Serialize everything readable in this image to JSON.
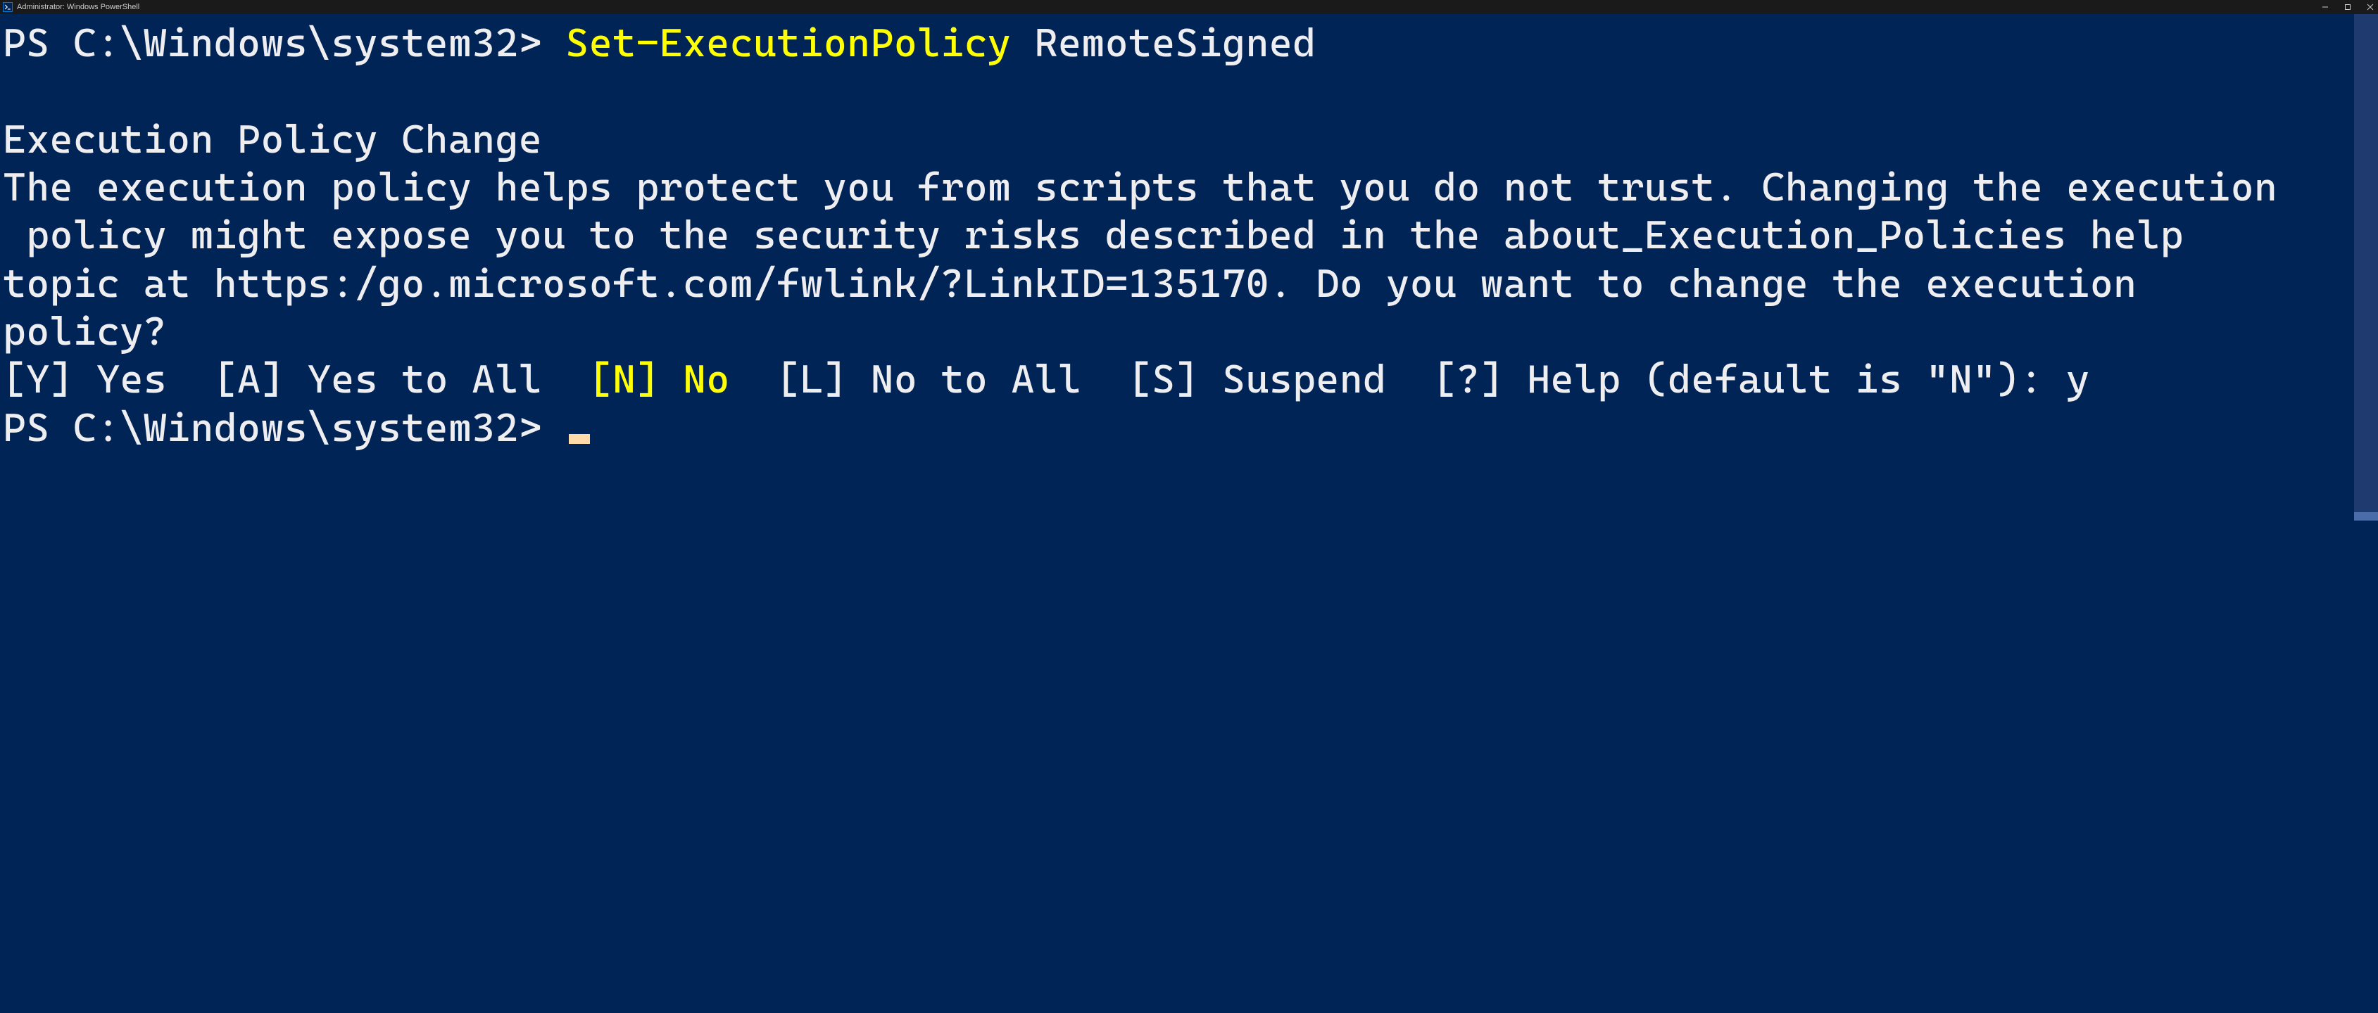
{
  "window": {
    "title": "Administrator: Windows PowerShell"
  },
  "terminal": {
    "line1": {
      "prompt": "PS C:\\Windows\\system32> ",
      "cmdlet": "Set-ExecutionPolicy",
      "space": " ",
      "arg": "RemoteSigned"
    },
    "blank": " ",
    "heading": "Execution Policy Change",
    "body": "The execution policy helps protect you from scripts that you do not trust. Changing the execution\n policy might expose you to the security risks described in the about_Execution_Policies help\ntopic at https:/go.microsoft.com/fwlink/?LinkID=135170. Do you want to change the execution\npolicy?",
    "choices": {
      "pre": "[Y] Yes  [A] Yes to All  ",
      "default": "[N] No",
      "post": "  [L] No to All  [S] Suspend  [?] Help (default is \"N\"): y"
    },
    "line2": {
      "prompt": "PS C:\\Windows\\system32> "
    }
  }
}
